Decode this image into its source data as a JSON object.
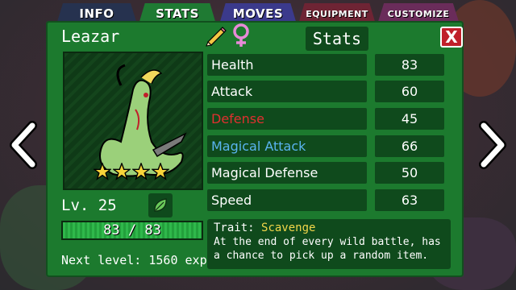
{
  "tabs": [
    {
      "label": "INFO"
    },
    {
      "label": "STATS"
    },
    {
      "label": "MOVES"
    },
    {
      "label": "EQUIPMENT"
    },
    {
      "label": "CUSTOMIZE"
    }
  ],
  "creature": {
    "name": "Leazar",
    "gender_icon": "female-icon",
    "stars": 4,
    "level_text": "Lv. 25",
    "hp_current": 83,
    "hp_max": 83,
    "hp_text": "83 / 83",
    "next_level_text": "Next level: 1560 exp"
  },
  "stats_panel": {
    "title": "Stats",
    "close_label": "X",
    "rows": [
      {
        "label": "Health",
        "value": "83",
        "color": "#ffffff"
      },
      {
        "label": "Attack",
        "value": "60",
        "color": "#ffffff"
      },
      {
        "label": "Defense",
        "value": "45",
        "color": "#e03030"
      },
      {
        "label": "Magical Attack",
        "value": "66",
        "color": "#5ab4f0"
      },
      {
        "label": "Magical Defense",
        "value": "50",
        "color": "#ffffff"
      },
      {
        "label": "Speed",
        "value": "63",
        "color": "#ffffff"
      }
    ]
  },
  "trait": {
    "prefix": "Trait:",
    "name": "Scavenge",
    "description": "At the end of every wild battle, has a chance to pick up a random item."
  },
  "icons": {
    "edit": "pencil-icon",
    "element": "leaf-icon",
    "prev": "chevron-left-icon",
    "next": "chevron-right-icon",
    "star": "star-icon"
  }
}
